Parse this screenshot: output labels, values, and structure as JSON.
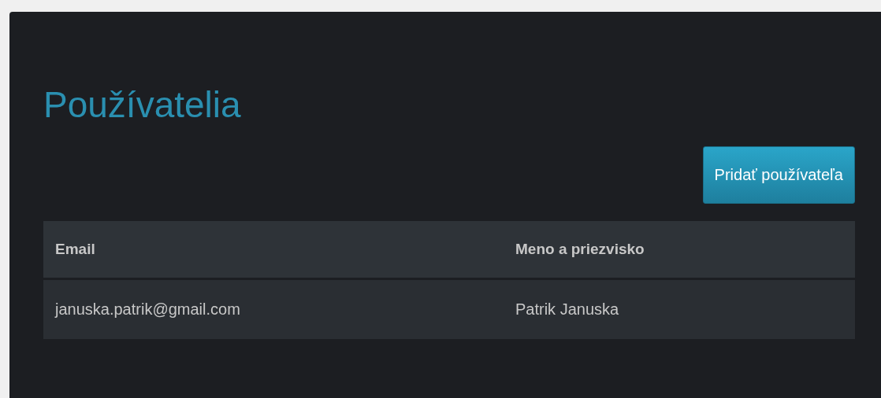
{
  "page": {
    "title": "Používatelia"
  },
  "add_button": {
    "label": "Pridať používateľa"
  },
  "table": {
    "columns": [
      "Email",
      "Meno a priezvisko"
    ],
    "rows": [
      [
        "januska.patrik@gmail.com",
        "Patrik Januska"
      ]
    ]
  }
}
